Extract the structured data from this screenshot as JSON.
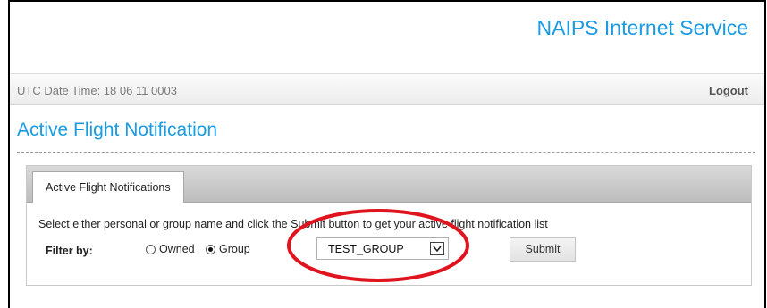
{
  "header": {
    "site_title": "NAIPS Internet Service"
  },
  "status_bar": {
    "utc_label": "UTC Date Time: 18 06 11 0003",
    "logout_label": "Logout"
  },
  "page": {
    "title": "Active Flight Notification"
  },
  "panel": {
    "tab_label": "Active Flight Notifications",
    "instruction": "Select either personal or group name and click the Submit button to get your active flight notification list",
    "filter_label": "Filter by:",
    "radios": [
      {
        "label": "Owned",
        "checked": false
      },
      {
        "label": "Group",
        "checked": true
      }
    ],
    "group_select": {
      "selected": "TEST_GROUP"
    },
    "submit_label": "Submit"
  },
  "colors": {
    "accent": "#1b9be0",
    "highlight": "#e0141e"
  },
  "icons": {
    "select_arrow": "chevron-down-icon"
  }
}
